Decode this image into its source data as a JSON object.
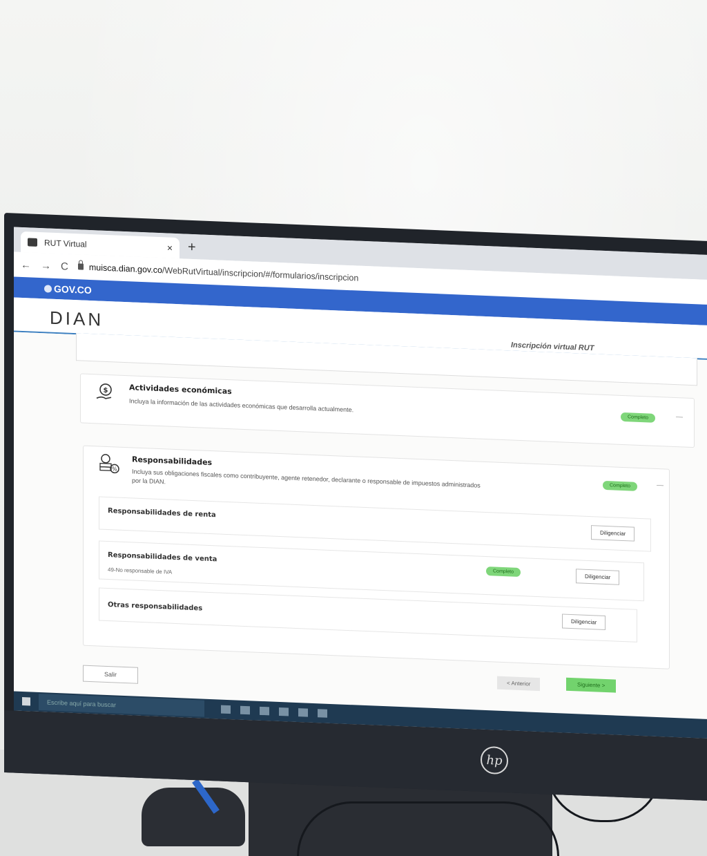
{
  "browser": {
    "tab_title": "RUT Virtual",
    "tab_close": "×",
    "new_tab": "+",
    "back": "←",
    "forward": "→",
    "reload": "C",
    "url_host": "muisca.dian.gov.co",
    "url_path": "/WebRutVirtual/inscripcion/#/formularios/inscripcion"
  },
  "gov_bar": {
    "label": "GOV.CO"
  },
  "header": {
    "logo": "DIAN",
    "subtitle": "Inscripción virtual RUT"
  },
  "sections": {
    "actividades": {
      "icon": "money-hand-icon",
      "title": "Actividades económicas",
      "description": "Incluya la información de las actividades económicas que desarrolla actualmente.",
      "badge": "Completo",
      "collapse": "—"
    },
    "responsabilidades": {
      "icon": "coins-percent-icon",
      "title": "Responsabilidades",
      "description": "Incluya sus obligaciones fiscales como contribuyente, agente retenedor, declarante o responsable de impuestos administrados por la DIAN.",
      "badge": "Completo",
      "collapse": "—",
      "subsections": [
        {
          "title": "Responsabilidades de renta",
          "note": "",
          "button": "Diligenciar"
        },
        {
          "title": "Responsabilidades de venta",
          "note": "49-No responsable de IVA",
          "badge": "Completo",
          "button": "Diligenciar"
        },
        {
          "title": "Otras responsabilidades",
          "note": "",
          "button": "Diligenciar"
        }
      ]
    }
  },
  "footer": {
    "back_button": "< Anterior",
    "next_button": "Siguiente >",
    "exit_button": "Salir"
  },
  "taskbar": {
    "search_placeholder": "Escribe aquí para buscar"
  },
  "colors": {
    "gov_blue": "#3366cc",
    "complete_green": "#7fd67a",
    "header_line": "#3a7ebf"
  }
}
